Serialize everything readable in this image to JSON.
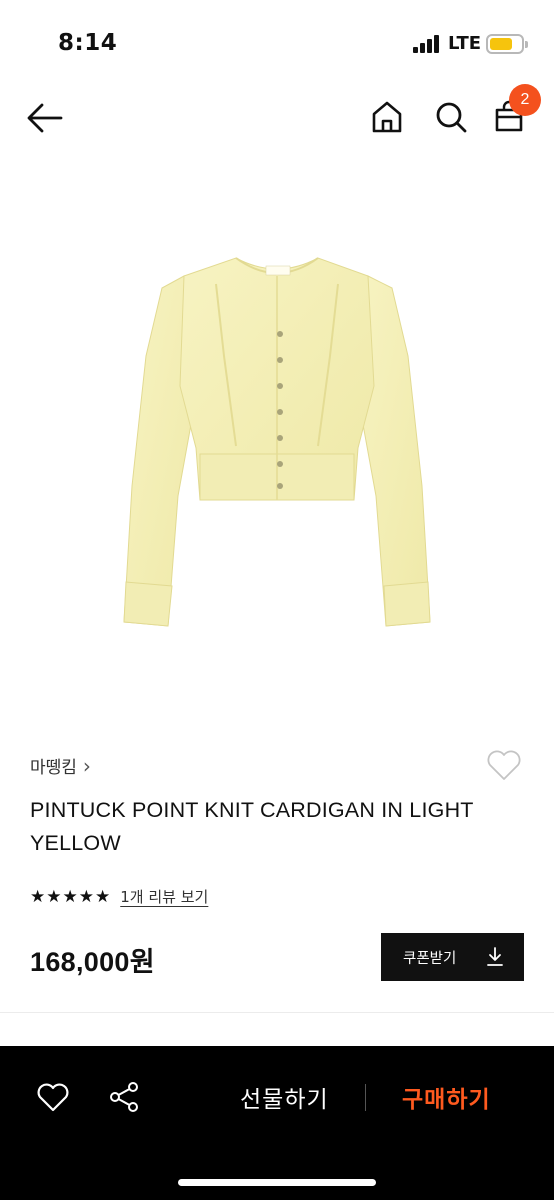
{
  "status_bar": {
    "time": "8:14",
    "carrier": "LTE",
    "battery_color": "#f6c40d"
  },
  "header": {
    "cart_count": "2",
    "badge_color": "#f4511e"
  },
  "product": {
    "brand": "마뗑킴",
    "brand_chevron": "›",
    "title": "PINTUCK POINT KNIT CARDIGAN IN LIGHT YELLOW",
    "rating_stars": 5,
    "review_link": "1개 리뷰 보기",
    "price": "168,000원",
    "coupon_button": "쿠폰받기",
    "image_color": "#f5f0b8"
  },
  "bottom_bar": {
    "gift_label": "선물하기",
    "buy_label": "구매하기",
    "buy_color": "#ff5a1f"
  }
}
